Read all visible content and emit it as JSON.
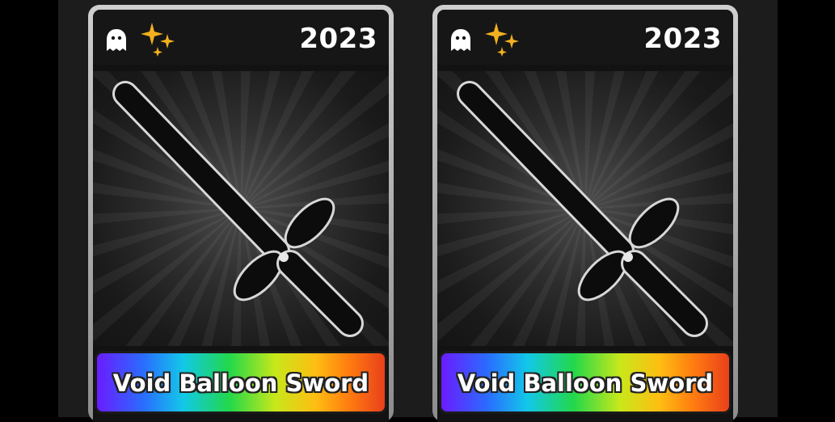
{
  "cards": [
    {
      "year": "2023",
      "item_name": "Void Balloon Sword",
      "icons": [
        "ghost-icon",
        "sparkles-icon"
      ],
      "name_bar_style": "rainbow"
    },
    {
      "year": "2023",
      "item_name": "Void Balloon Sword",
      "icons": [
        "ghost-icon",
        "sparkles-icon"
      ],
      "name_bar_style": "rainbow"
    }
  ],
  "colors": {
    "background": "#000000",
    "card_border": "#c0c0c0",
    "sparkle": "#f2b01e",
    "year_text": "#ffffff"
  }
}
